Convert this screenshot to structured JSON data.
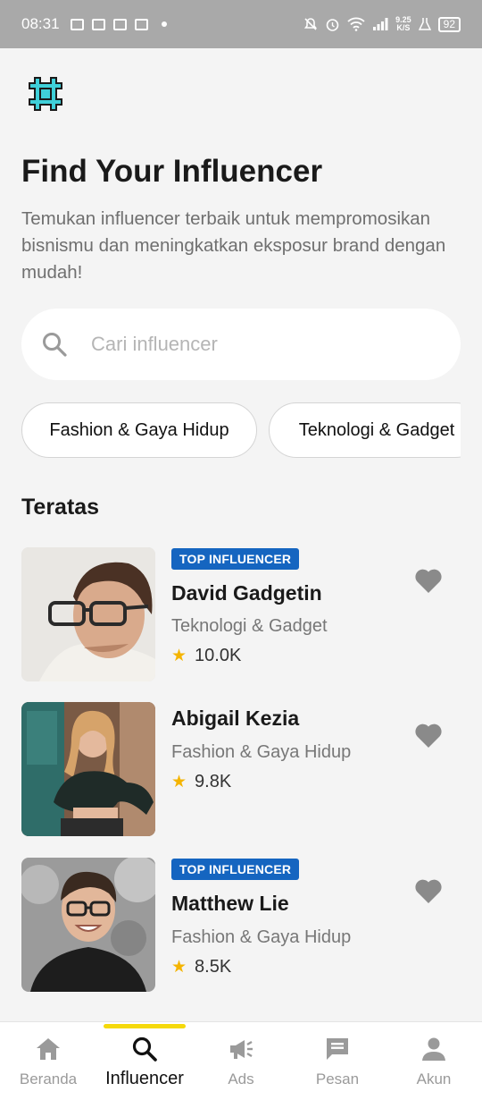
{
  "status_bar": {
    "time": "08:31",
    "net_speed_value": "9.25",
    "net_speed_unit": "K/S",
    "battery": "92"
  },
  "header": {
    "title": "Find Your Influencer",
    "subtitle": "Temukan influencer terbaik untuk mempromosikan bisnismu dan meningkatkan eksposur brand dengan mudah!"
  },
  "search": {
    "placeholder": "Cari influencer",
    "value": ""
  },
  "categories": [
    "Fashion & Gaya Hidup",
    "Teknologi & Gadget"
  ],
  "section": {
    "title": "Teratas"
  },
  "influencers": [
    {
      "badge": "TOP INFLUENCER",
      "name": "David Gadgetin",
      "category": "Teknologi & Gadget",
      "rating": "10.0K"
    },
    {
      "badge": "",
      "name": "Abigail Kezia",
      "category": "Fashion & Gaya Hidup",
      "rating": "9.8K"
    },
    {
      "badge": "TOP INFLUENCER",
      "name": "Matthew Lie",
      "category": "Fashion & Gaya Hidup",
      "rating": "8.5K"
    }
  ],
  "bottom_nav": [
    {
      "label": "Beranda",
      "icon": "home-icon"
    },
    {
      "label": "Influencer",
      "icon": "search-icon",
      "active": true
    },
    {
      "label": "Ads",
      "icon": "megaphone-icon"
    },
    {
      "label": "Pesan",
      "icon": "chat-icon"
    },
    {
      "label": "Akun",
      "icon": "person-icon"
    }
  ],
  "colors": {
    "badge": "#1565c0",
    "star": "#f4b400",
    "nav_indicator": "#f5d90a",
    "logo": "#3fd0d9",
    "favorite": "#8a8a8a"
  }
}
